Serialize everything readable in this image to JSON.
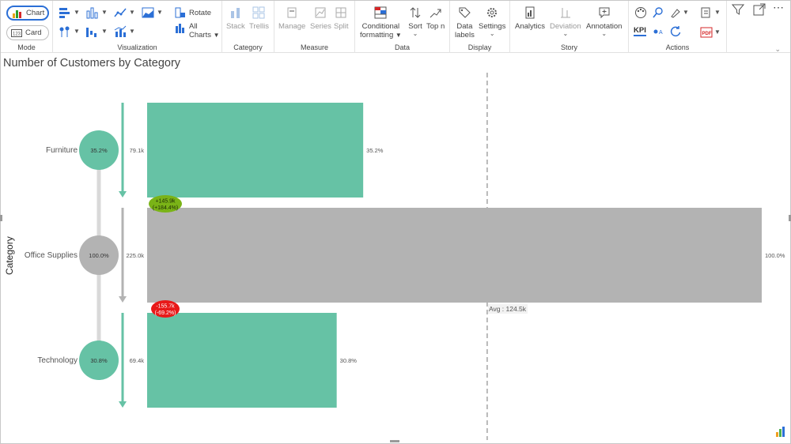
{
  "ribbon": {
    "mode": {
      "label": "Mode",
      "chart_label": "Chart",
      "card_label": "Card"
    },
    "visualization": {
      "label": "Visualization",
      "rotate_label": "Rotate",
      "all_charts_label_1": "All",
      "all_charts_label_2": "Charts"
    },
    "category": {
      "label": "Category",
      "stack_label": "Stack",
      "trellis_label": "Trellis"
    },
    "measure": {
      "label": "Measure",
      "manage_label": "Manage",
      "series_label": "Series",
      "split_label": "Split"
    },
    "data": {
      "label": "Data",
      "cond_format_label_1": "Conditional",
      "cond_format_label_2": "formatting",
      "sort_label": "Sort",
      "topn_label": "Top n"
    },
    "display": {
      "label": "Display",
      "data_labels_label_1": "Data",
      "data_labels_label_2": "labels",
      "settings_label": "Settings"
    },
    "story": {
      "label": "Story",
      "analytics_label": "Analytics",
      "deviation_label": "Deviation",
      "annotation_label": "Annotation"
    },
    "actions": {
      "label": "Actions",
      "kpi_label": "KPI"
    }
  },
  "colors": {
    "green": "#66c2a5",
    "gray": "#b3b3b3",
    "arrow_green": "#66c2a5",
    "arrow_gray": "#b3b3b3",
    "positive_badge": "#7ab317",
    "negative_badge": "#e81919",
    "accent": "#2b6fd6"
  },
  "chart_data": {
    "type": "bar",
    "title": "Number of Customers by Category",
    "ylabel": "Category",
    "categories": [
      "Furniture",
      "Office Supplies",
      "Technology"
    ],
    "values": [
      79.1,
      225.0,
      69.4
    ],
    "value_labels": [
      "79.1k",
      "225.0k",
      "69.4k"
    ],
    "percent_labels": [
      "35.2%",
      "100.0%",
      "30.8%"
    ],
    "circle_labels": [
      "35.2%",
      "100.0%",
      "30.8%"
    ],
    "bar_colors": [
      "#66c2a5",
      "#b3b3b3",
      "#66c2a5"
    ],
    "xlim": [
      0,
      225.0
    ],
    "average": {
      "value": 124.5,
      "label": "Avg : 124.5k"
    },
    "deltas": [
      {
        "between": [
          "Furniture",
          "Office Supplies"
        ],
        "line1": "+145.9k",
        "line2": "(+184.4%)",
        "sign": "positive"
      },
      {
        "between": [
          "Office Supplies",
          "Technology"
        ],
        "line1": "-155.7k",
        "line2": "(-69.2%)",
        "sign": "negative"
      }
    ]
  }
}
